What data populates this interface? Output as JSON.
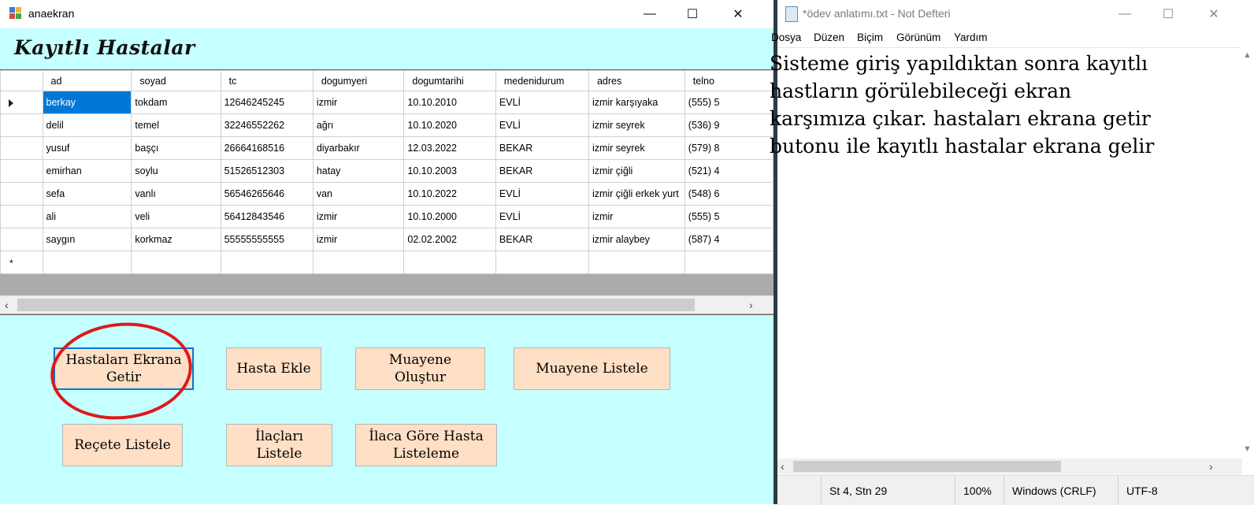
{
  "left_window": {
    "title": "anaekran",
    "controls": {
      "minimize": "—",
      "maximize": "☐",
      "close": "✕"
    },
    "form_title": "Kayıtlı Hastalar",
    "grid": {
      "columns": [
        "ad",
        "soyad",
        "tc",
        "dogumyeri",
        "dogumtarihi",
        "medenidurum",
        "adres",
        "telno"
      ],
      "rows": [
        [
          "berkay",
          "tokdam",
          "12646245245",
          "izmir",
          "10.10.2010",
          "EVLİ",
          "izmir karşıyaka",
          "(555) 5"
        ],
        [
          "delil",
          "temel",
          "32246552262",
          "ağrı",
          "10.10.2020",
          "EVLİ",
          "izmir seyrek",
          "(536) 9"
        ],
        [
          "yusuf",
          "başçı",
          "26664168516",
          "diyarbakır",
          "12.03.2022",
          "BEKAR",
          "izmir seyrek",
          "(579) 8"
        ],
        [
          "emirhan",
          "soylu",
          "51526512303",
          "hatay",
          "10.10.2003",
          "BEKAR",
          "izmir çiğli",
          "(521) 4"
        ],
        [
          "sefa",
          "vanlı",
          "56546265646",
          "van",
          "10.10.2022",
          "EVLİ",
          "izmir çiğli erkek yurt",
          "(548) 6"
        ],
        [
          "ali",
          "veli",
          "56412843546",
          "izmir",
          "10.10.2000",
          "EVLİ",
          "izmir",
          "(555) 5"
        ],
        [
          "saygın",
          "korkmaz",
          "55555555555",
          "izmir",
          "02.02.2002",
          "BEKAR",
          "izmir alaybey",
          "(587) 4"
        ]
      ],
      "new_row_marker": "*"
    },
    "buttons": {
      "hastalari_getir": "Hastaları Ekrana Getir",
      "hasta_ekle": "Hasta Ekle",
      "muayene_olustur": "Muayene Oluştur",
      "muayene_listele": "Muayene Listele",
      "recete_listele": "Reçete Listele",
      "ilaclari_listele": "İlaçları Listele",
      "ilaca_gore": "İlaca Göre Hasta Listeleme"
    },
    "colors": {
      "form_bg": "#c5ffff",
      "button_bg": "#ffdfc5",
      "selection": "#0078d7",
      "annotation": "#e01818"
    }
  },
  "notepad": {
    "title": "*ödev anlatımı.txt - Not Defteri",
    "controls": {
      "minimize": "—",
      "maximize": "☐",
      "close": "✕"
    },
    "menu": [
      "Dosya",
      "Düzen",
      "Biçim",
      "Görünüm",
      "Yardım"
    ],
    "content": "Sisteme giriş yapıldıktan sonra kayıtlı\nhastların görülebileceği ekran\nkarşımıza çıkar. hastaları ekrana getir\nbutonu ile kayıtlı hastalar ekrana gelir",
    "status": {
      "position": "St 4, Stn 29",
      "zoom": "100%",
      "line_ending": "Windows (CRLF)",
      "encoding": "UTF-8"
    }
  }
}
